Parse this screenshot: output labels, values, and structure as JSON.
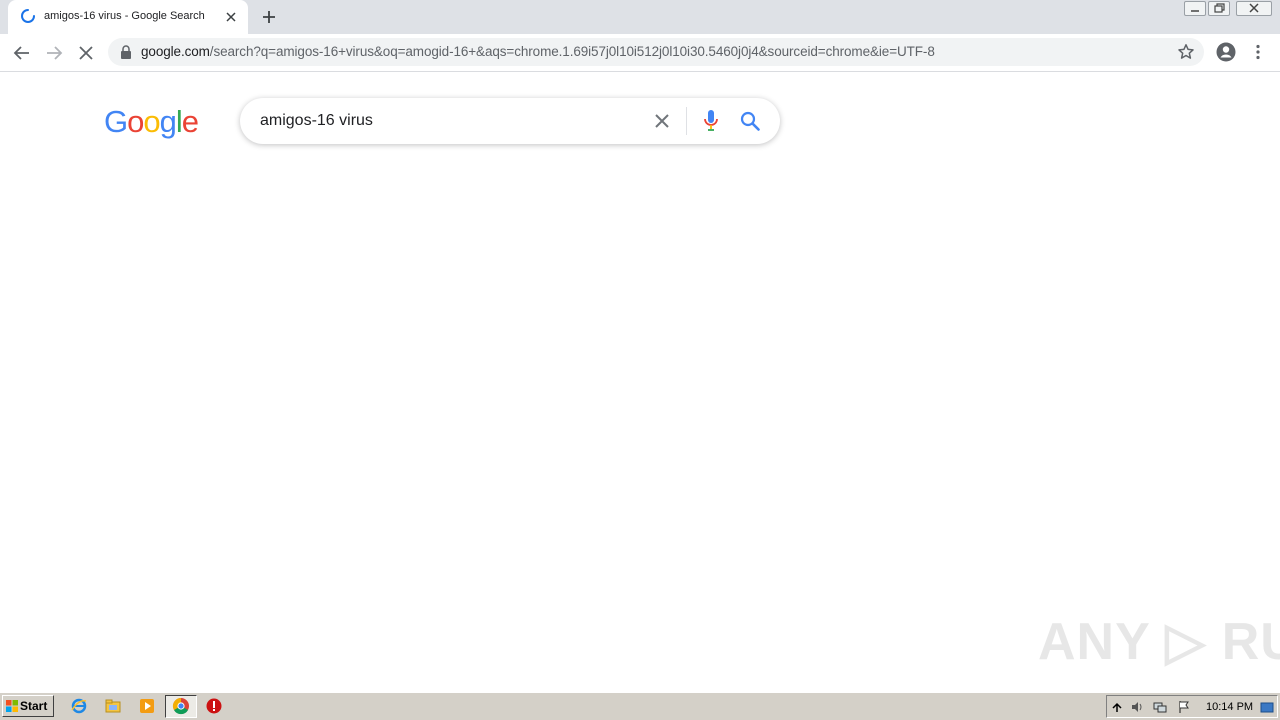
{
  "browser": {
    "tab": {
      "title": "amigos-16 virus - Google Search"
    },
    "url_host": "google.com",
    "url_path": "/search?q=amigos-16+virus&oq=amogid-16+&aqs=chrome.1.69i57j0l10i512j0l10i30.5460j0j4&sourceid=chrome&ie=UTF-8"
  },
  "page": {
    "logo_letters": [
      "G",
      "o",
      "o",
      "g",
      "l",
      "e"
    ],
    "search_value": "amigos-16 virus"
  },
  "colors": {
    "google_blue": "#4285f4",
    "google_red": "#ea4335",
    "google_yellow": "#fbbc05",
    "google_green": "#34a853"
  },
  "watermark": "ANY ▷ RUN",
  "taskbar": {
    "start_label": "Start",
    "clock": "10:14 PM",
    "apps": [
      "ie-icon",
      "explorer-folder-icon",
      "media-player-icon",
      "chrome-icon",
      "alert-app-icon"
    ]
  }
}
